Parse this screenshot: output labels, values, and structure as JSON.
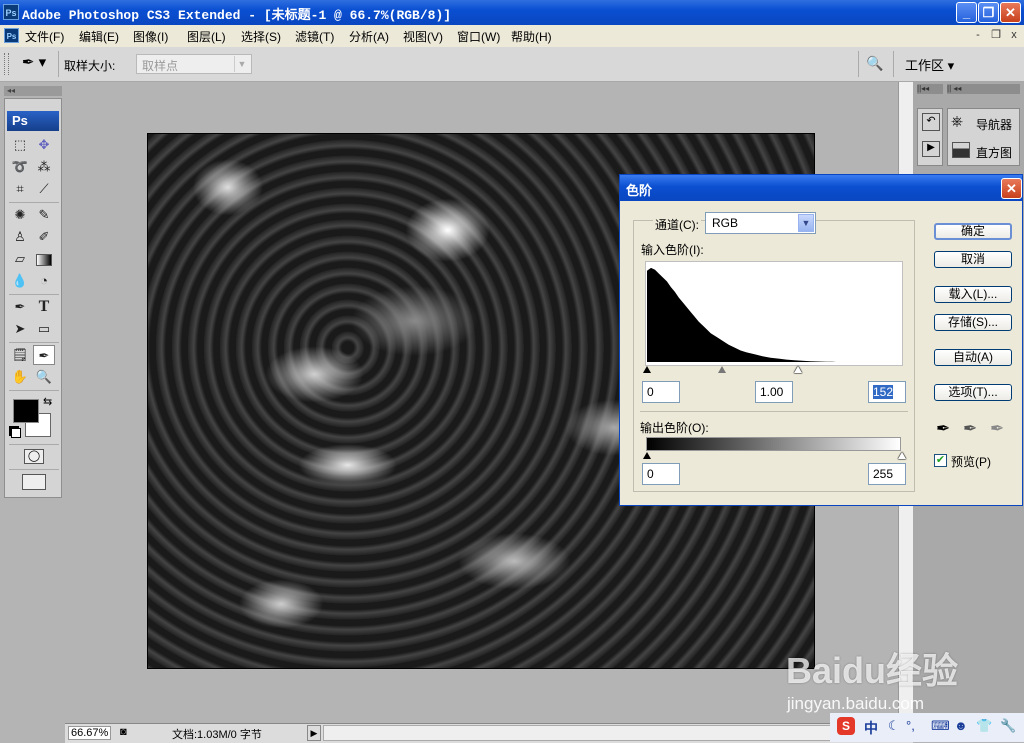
{
  "window": {
    "title": "Adobe Photoshop CS3 Extended - [未标题-1 @ 66.7%(RGB/8)]",
    "app_icon": "Ps",
    "controls": {
      "minimize": "_",
      "restore": "❐",
      "close": "✕"
    }
  },
  "menu": {
    "items": [
      "文件(F)",
      "编辑(E)",
      "图像(I)",
      "图层(L)",
      "选择(S)",
      "滤镜(T)",
      "分析(A)",
      "视图(V)",
      "窗口(W)",
      "帮助(H)"
    ],
    "doc_controls": {
      "minimize": "-",
      "restore": "❐",
      "close": "x"
    }
  },
  "options_bar": {
    "sample_size_label": "取样大小:",
    "sample_size_value": "取样点",
    "workspace_label": "工作区"
  },
  "toolbox": {
    "logo": "Ps",
    "type_tool": "T",
    "tools": [
      "marquee-tool",
      "move-tool",
      "lasso-tool",
      "magic-wand-tool",
      "crop-tool",
      "slice-tool",
      "healing-brush-tool",
      "brush-tool",
      "clone-stamp-tool",
      "history-brush-tool",
      "eraser-tool",
      "gradient-tool",
      "blur-tool",
      "dodge-tool",
      "pen-tool",
      "type-tool",
      "path-selection-tool",
      "shape-tool",
      "notes-tool",
      "eyedropper-tool",
      "hand-tool",
      "zoom-tool"
    ],
    "active_tool": "eyedropper-tool",
    "foreground_color": "#000000",
    "background_color": "#ffffff"
  },
  "status_bar": {
    "zoom": "66.67%",
    "doc_info": "文档:1.03M/0 字节"
  },
  "panels": {
    "navigator": "导航器",
    "histogram": "直方图"
  },
  "levels_dialog": {
    "title": "色阶",
    "channel_label": "通道(C):",
    "channel_value": "RGB",
    "input_levels_label": "输入色阶(I):",
    "input_black": "0",
    "input_gamma": "1.00",
    "input_white": "152",
    "output_levels_label": "输出色阶(O):",
    "output_black": "0",
    "output_white": "255",
    "buttons": {
      "ok": "确定",
      "cancel": "取消",
      "load": "载入(L)...",
      "save": "存储(S)...",
      "auto": "自动(A)",
      "options": "选项(T)..."
    },
    "preview_label": "预览(P)",
    "preview_checked": true
  },
  "histogram_data": {
    "type": "area",
    "x_range": [
      0,
      255
    ],
    "y_range": [
      0,
      1
    ],
    "x": [
      0,
      4,
      8,
      12,
      16,
      20,
      24,
      28,
      32,
      36,
      40,
      44,
      48,
      52,
      56,
      60,
      64,
      70,
      76,
      82,
      88,
      94,
      100,
      108,
      116,
      124,
      132,
      140,
      148,
      156,
      164,
      172,
      180,
      186,
      190,
      200,
      255
    ],
    "y": [
      0.95,
      0.98,
      0.96,
      0.92,
      0.88,
      0.84,
      0.78,
      0.73,
      0.67,
      0.62,
      0.57,
      0.52,
      0.47,
      0.42,
      0.38,
      0.34,
      0.3,
      0.26,
      0.22,
      0.18,
      0.15,
      0.12,
      0.1,
      0.08,
      0.06,
      0.045,
      0.035,
      0.025,
      0.018,
      0.012,
      0.008,
      0.005,
      0.003,
      0.002,
      0.0,
      0.0,
      0.0
    ]
  },
  "watermark": {
    "brand": "Baidu经验",
    "url": "jingyan.baidu.com"
  },
  "tray": {
    "ime": "中"
  },
  "colors": {
    "xp_blue": "#0a46c0",
    "dialog_bg": "#ece9d8",
    "canvas_bg": "#b4b4b4"
  }
}
